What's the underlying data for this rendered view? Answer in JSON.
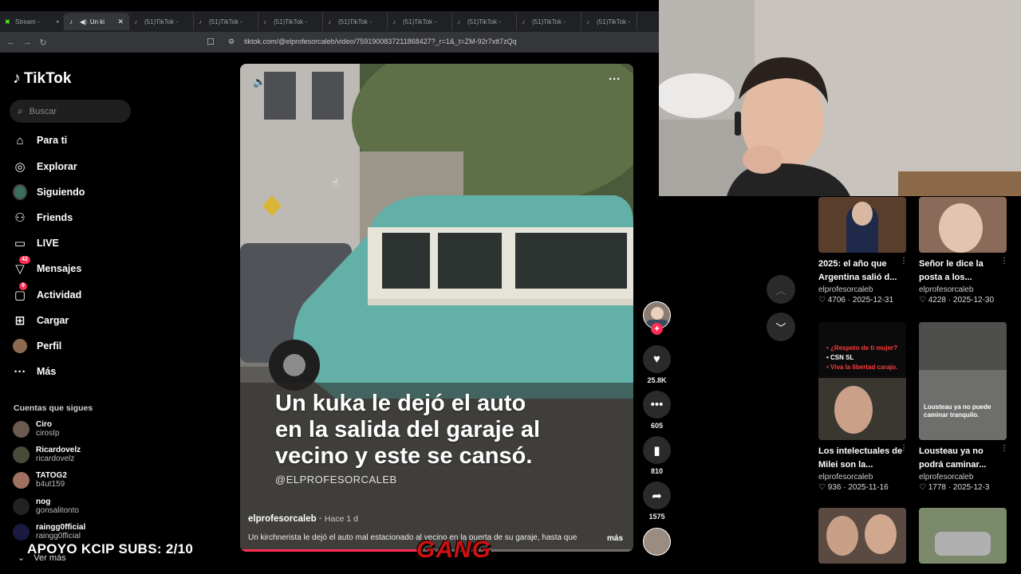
{
  "browser": {
    "tabs": [
      {
        "label": "Stream -",
        "active": false,
        "icon": "stream-icon"
      },
      {
        "label": "Un ki",
        "active": true,
        "icon": "tiktok-icon"
      },
      {
        "label": "(51)TikTok - ",
        "active": false,
        "icon": "tiktok-icon"
      },
      {
        "label": "(51)TikTok - ",
        "active": false,
        "icon": "tiktok-icon"
      },
      {
        "label": "(51)TikTok - ",
        "active": false,
        "icon": "tiktok-icon"
      },
      {
        "label": "(51)TikTok - ",
        "active": false,
        "icon": "tiktok-icon"
      },
      {
        "label": "(51)TikTok - ",
        "active": false,
        "icon": "tiktok-icon"
      },
      {
        "label": "(51)TikTok - ",
        "active": false,
        "icon": "tiktok-icon"
      },
      {
        "label": "(51)TikTok - ",
        "active": false,
        "icon": "tiktok-icon"
      },
      {
        "label": "(51)TikTok - ",
        "active": false,
        "icon": "tiktok-icon"
      }
    ],
    "url": "tiktok.com/@elprofesorcaleb/video/7591900837211868427?_r=1&_t=ZM-92r7xtt7zQq"
  },
  "sidebar": {
    "logo": "TikTok",
    "search_placeholder": "Buscar",
    "nav": [
      {
        "label": "Para ti",
        "icon": "home-icon"
      },
      {
        "label": "Explorar",
        "icon": "compass-icon"
      },
      {
        "label": "Siguiendo",
        "icon": "following-avatar-icon"
      },
      {
        "label": "Friends",
        "icon": "friends-icon"
      },
      {
        "label": "LIVE",
        "icon": "live-icon"
      },
      {
        "label": "Mensajes",
        "icon": "messages-icon",
        "badge": "42"
      },
      {
        "label": "Actividad",
        "icon": "activity-icon",
        "badge": "9"
      },
      {
        "label": "Cargar",
        "icon": "upload-icon"
      },
      {
        "label": "Perfil",
        "icon": "profile-avatar-icon"
      },
      {
        "label": "Más",
        "icon": "more-icon"
      }
    ],
    "following_title": "Cuentas que sigues",
    "accounts": [
      {
        "name": "Ciro",
        "handle": "cirosIp"
      },
      {
        "name": "Ricardovelz",
        "handle": "ricardovelz"
      },
      {
        "name": "TATOG2",
        "handle": "b4ut159"
      },
      {
        "name": "nog",
        "handle": "gonsalitonto"
      },
      {
        "name": "raingg0fficial",
        "handle": "raingg0fficial"
      }
    ],
    "see_more": "Ver más"
  },
  "overlay": {
    "promo": "APOYO KCIP SUBS: 2/10",
    "watermark": "GANG"
  },
  "video": {
    "caption_lines": [
      "Un kuka le dejó el auto",
      "en la salida del garaje al",
      "vecino y este se cansó."
    ],
    "caption_handle": "@ELPROFESORCALEB",
    "author": "elprofesorcaleb",
    "posted": "Hace 1 d",
    "description": "Un kirchnerista le dejó el auto mal estacionado al vecino en la puerta de su garaje, hasta que",
    "more_label": "más",
    "progress": 0.45,
    "likes": "25.8K",
    "comments": "605",
    "saves": "810",
    "shares": "1575"
  },
  "related": [
    {
      "title": "2025: el año que Argentina salió d...",
      "user": "elprofesorcaleb",
      "likes": "4706",
      "date": "2025-12-31"
    },
    {
      "title": "Señor le dice la posta a los...",
      "user": "elprofesorcaleb",
      "likes": "4228",
      "date": "2025-12-30"
    },
    {
      "title": "Los intelectuales de Milei son la...",
      "user": "elprofesorcaleb",
      "likes": "936",
      "date": "2025-11-16",
      "thumb_text": [
        "• ¿Respeto de ti mujer?",
        "• CSN SL",
        "• Viva la libertad carajo."
      ]
    },
    {
      "title": "Lousteau ya no podrá caminar...",
      "user": "elprofesorcaleb",
      "likes": "1778",
      "date": "2025-12-3",
      "thumb_text": [
        "Lousteau ya no puede",
        "caminar tranquilo."
      ]
    }
  ],
  "colors": {
    "accent": "#fe2c55",
    "bg": "#000000",
    "chrome": "#202124"
  }
}
